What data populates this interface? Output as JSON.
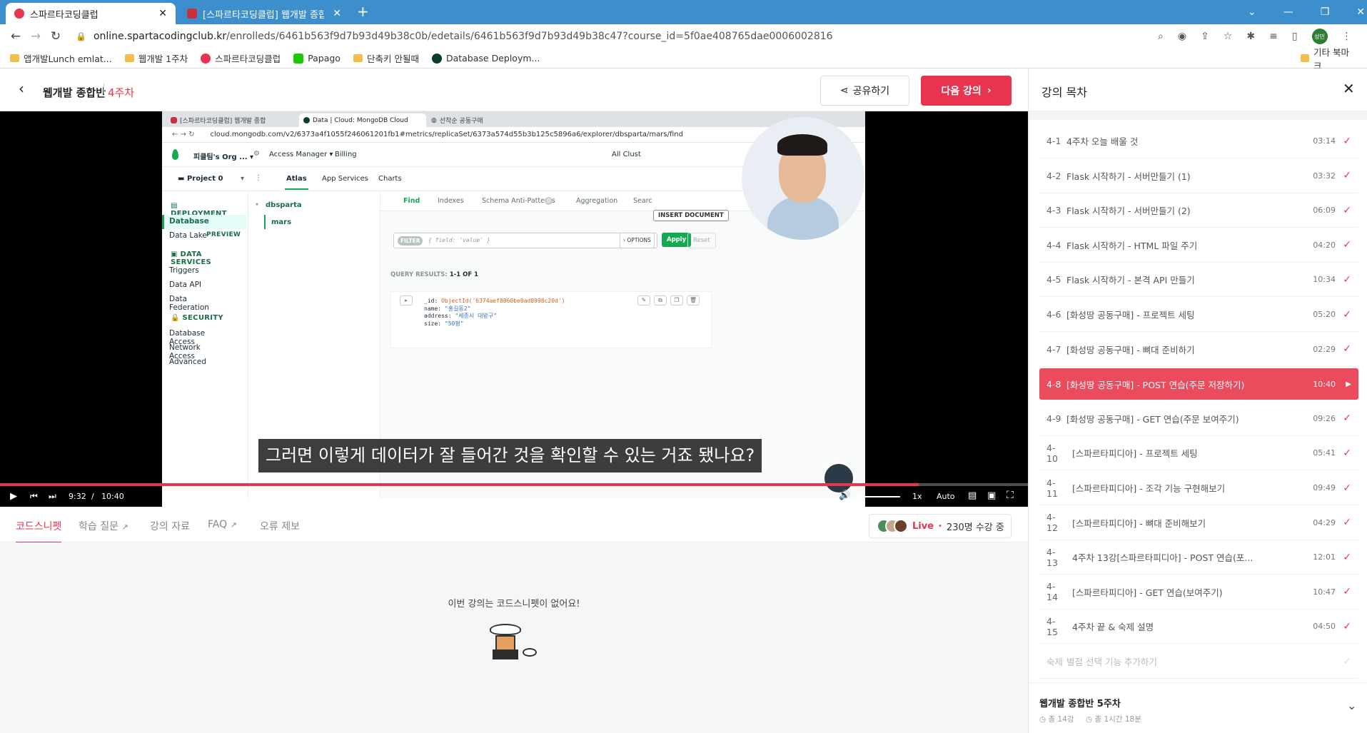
{
  "browser": {
    "tabs": [
      {
        "title": "스파르타코딩클럽",
        "active": true
      },
      {
        "title": "[스파르타코딩클럽] 웹개발 종합",
        "active": false
      }
    ],
    "url_host": "online.spartacodingclub.kr",
    "url_path": "/enrolleds/6461b563f9d7b93d49b38c0b/edetails/6461b563f9d7b93d49b38c47?course_id=5f0ae408765dae0006002816",
    "profile_initial": "성민",
    "bookmarks": [
      "앱개발Lunch emlat...",
      "웹개발 1주차",
      "스파르타코딩클럽",
      "Papago",
      "단축키 안될때",
      "Database Deploym..."
    ],
    "bookmarks_other": "기타 북마크"
  },
  "header": {
    "back_icon": "chevron-left-icon",
    "course_title": "웹개발 종합반",
    "week": "4주차",
    "share_label": "공유하기",
    "next_label": "다음 강의"
  },
  "video": {
    "subtitle": "그러면 이렇게 데이터가 잘 들어간 것을 확인할 수 있는 거죠 됐나요?",
    "current_time": "9:32",
    "separator": "/",
    "total_time": "10:40",
    "progress": 0.8937,
    "speed": "1x",
    "quality": "Auto",
    "inner": {
      "tabs": [
        "[스파르타코딩클럽] 웹개발 종합",
        "Data | Cloud: MongoDB Cloud",
        "선착순 공동구매"
      ],
      "url": "cloud.mongodb.com/v2/6373a4f1055f246061201fb1#metrics/replicaSet/6373a574d55b3b125c5896a6/explorer/dbsparta/mars/find",
      "org": "피클팀's Org ...",
      "access_manager": "Access Manager",
      "billing": "Billing",
      "all_clusters": "All Clust",
      "project": "Project 0",
      "top_tabs": [
        "Atlas",
        "App Services",
        "Charts"
      ],
      "sections": [
        {
          "title": "DEPLOYMENT",
          "items": [
            "Database",
            "Data Lake"
          ]
        },
        {
          "title": "DATA SERVICES",
          "items": [
            "Triggers",
            "Data API",
            "Data Federation"
          ]
        },
        {
          "title": "SECURITY",
          "items": [
            "Database Access",
            "Network Access",
            "Advanced"
          ]
        }
      ],
      "preview_badge": "PREVIEW",
      "db_name": "dbsparta",
      "collection": "mars",
      "coll_tabs": [
        "Find",
        "Indexes",
        "Schema Anti-Patterns",
        "Aggregation",
        "Search"
      ],
      "schema_count": "0",
      "insert_doc": "INSERT DOCUMENT",
      "filter_label": "FILTER",
      "filter_placeholder": "{ field: 'value' }",
      "options": "OPTIONS",
      "apply": "Apply",
      "reset": "Reset",
      "query_results_label": "QUERY RESULTS:",
      "query_results_value": "1-1 OF 1",
      "doc": [
        {
          "key": "_id:",
          "val": "ObjectId('6374aef8860be0ad8998c20d')"
        },
        {
          "key": "name:",
          "val": "\"홍길동2\""
        },
        {
          "key": "address:",
          "val": "\"세종시 대왕구\""
        },
        {
          "key": "size:",
          "val": "\"50평\""
        }
      ]
    }
  },
  "below_tabs": [
    {
      "label": "코드스니펫",
      "active": true
    },
    {
      "label": "학습 질문",
      "external": true
    },
    {
      "label": "강의 자료"
    },
    {
      "label": "FAQ",
      "external": true
    },
    {
      "label": "오류 제보"
    }
  ],
  "live": {
    "label": "Live",
    "text": "230명 수강 중"
  },
  "empty_message": "이번 강의는 코드스니펫이 없어요!",
  "sidebar": {
    "title": "강의 목차",
    "lessons": [
      {
        "num": "4-1",
        "title": "4주차 오늘 배울 것",
        "dur": "03:14",
        "done": true
      },
      {
        "num": "4-2",
        "title": "Flask 시작하기 - 서버만들기 (1)",
        "dur": "03:32",
        "done": true
      },
      {
        "num": "4-3",
        "title": "Flask 시작하기 - 서버만들기 (2)",
        "dur": "06:09",
        "done": true
      },
      {
        "num": "4-4",
        "title": "Flask 시작하기 - HTML 파일 주기",
        "dur": "04:20",
        "done": true
      },
      {
        "num": "4-5",
        "title": "Flask 시작하기 - 본격 API 만들기",
        "dur": "10:34",
        "done": true
      },
      {
        "num": "4-6",
        "title": "[화성땅 공동구매] - 프로젝트 세팅",
        "dur": "05:20",
        "done": true
      },
      {
        "num": "4-7",
        "title": "[화성땅 공동구매] - 뼈대 준비하기",
        "dur": "02:29",
        "done": true
      },
      {
        "num": "4-8",
        "title": "[화성땅 공동구매] - POST 연습(주문 저장하기)",
        "dur": "10:40",
        "done": false,
        "active": true
      },
      {
        "num": "4-9",
        "title": "[화성땅 공동구매] - GET 연습(주문 보여주기)",
        "dur": "09:26",
        "done": true
      },
      {
        "num": "4-10",
        "title": "[스파르타피디아] - 프로젝트 세팅",
        "dur": "05:41",
        "done": true
      },
      {
        "num": "4-11",
        "title": "[스파르타피디아] - 조각 기능 구현해보기",
        "dur": "09:49",
        "done": true
      },
      {
        "num": "4-12",
        "title": "[스파르타피디아] - 뼈대 준비해보기",
        "dur": "04:29",
        "done": true
      },
      {
        "num": "4-13",
        "title": "4주차 13강[스파르타피디아] - POST 연습(포...",
        "dur": "12:01",
        "done": true
      },
      {
        "num": "4-14",
        "title": "[스파르타피디아] - GET 연습(보여주기)",
        "dur": "10:47",
        "done": true
      },
      {
        "num": "4-15",
        "title": "4주차 끝 & 숙제 설명",
        "dur": "04:50",
        "done": true
      },
      {
        "num": "숙제",
        "title": "별점 선택 기능 추가하기",
        "dur": "",
        "done": false,
        "dim": true
      }
    ],
    "next_week": {
      "title": "웹개발 종합반 5주차",
      "count": "총 14강",
      "duration": "총 1시간 18분"
    }
  },
  "colors": {
    "accent": "#e8344e",
    "chrome_blue": "#3c8ecd",
    "mongo_green": "#13aa52"
  }
}
